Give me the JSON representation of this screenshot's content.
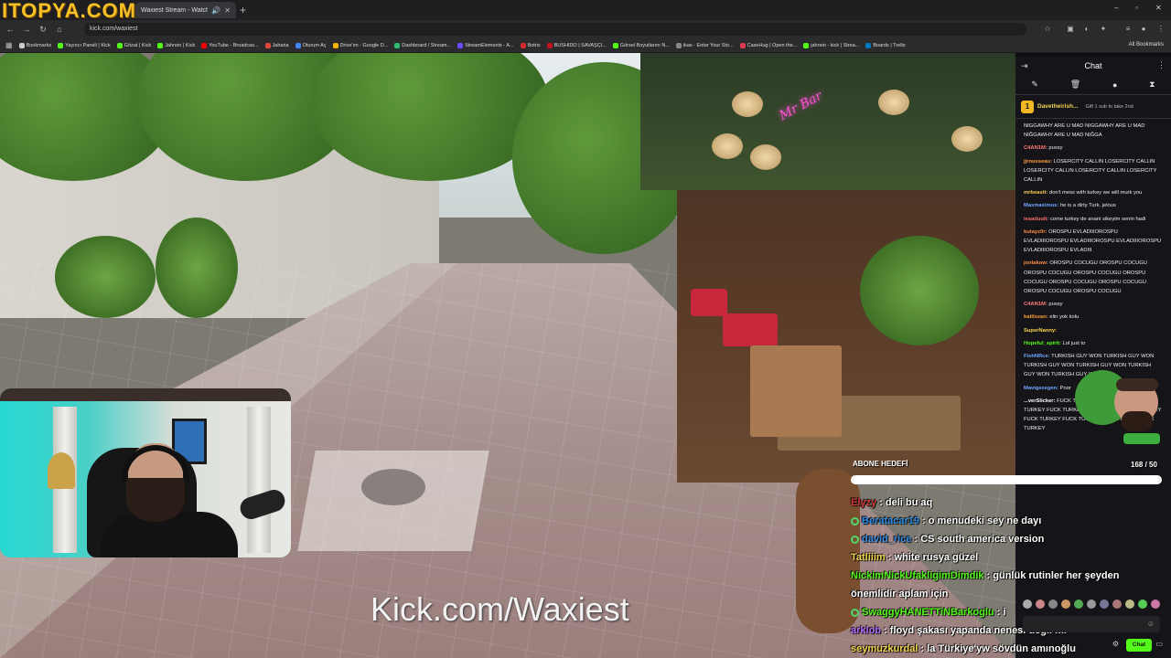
{
  "browser": {
    "watermark": "ITOPYA.COM",
    "tab_title": "Waxiest Stream - Watch Li...",
    "tab_audio_icon": "speaker-icon",
    "new_tab": "+",
    "url": "kick.com/waxiest",
    "window_controls": [
      "–",
      "▫",
      "✕"
    ]
  },
  "bookmarks": {
    "items": [
      {
        "label": "Bookmarks",
        "color": "#cccccc"
      },
      {
        "label": "Yayıncı Paneli | Kick",
        "color": "#53fc18"
      },
      {
        "label": "Gözat | Kick",
        "color": "#53fc18"
      },
      {
        "label": "Jahrein | Kick",
        "color": "#53fc18"
      },
      {
        "label": "YouTube - Broadcas...",
        "color": "#ff0000"
      },
      {
        "label": "Jaharia",
        "color": "#e0463c"
      },
      {
        "label": "Oturum Aç",
        "color": "#4285f4"
      },
      {
        "label": "Drive'ım - Google D...",
        "color": "#f4b400"
      },
      {
        "label": "Dashboard / Stream...",
        "color": "#2dbb6c"
      },
      {
        "label": "StreamElements - A...",
        "color": "#6b4bff"
      },
      {
        "label": "Botrix",
        "color": "#d32a2a"
      },
      {
        "label": "BUSHIDO | SAVAŞÇI...",
        "color": "#c1121f"
      },
      {
        "label": "Görsel Boyutlarını N...",
        "color": "#53fc18"
      },
      {
        "label": "ikas - Enter Your Sto...",
        "color": "#888888"
      },
      {
        "label": "CaseHug | Open the...",
        "color": "#e23a50"
      },
      {
        "label": "jahrein - kick | Strea...",
        "color": "#53fc18"
      },
      {
        "label": "Boards | Trello",
        "color": "#0079bf"
      }
    ],
    "right": "All Bookmarks"
  },
  "video": {
    "watermark_text": "Kick.com/Waxiest",
    "neon_sign": "Mr Bar"
  },
  "sub_goal": {
    "label": "ABONE HEDEFİ",
    "count": "168 / 50",
    "progress": 1.0
  },
  "overlay_chat": [
    {
      "user": "Elyzy",
      "text": ": deli bu aq",
      "color": "#d63b3b",
      "badge": false
    },
    {
      "user": "Beratacar19",
      "text": ": o menudeki sey ne dayı",
      "color": "#2f8fe6",
      "badge": true
    },
    {
      "user": "david_rice",
      "text": ": CS south america version",
      "color": "#3a8fe8",
      "badge": true
    },
    {
      "user": "Tatliiim",
      "text": ": white rusya güzel",
      "color": "#f2d650",
      "badge": false
    },
    {
      "user": "NickimNickUfakligimDimdik",
      "text": ": günlük rutinler her şeyden",
      "color": "#53fc18",
      "badge": false
    },
    {
      "user": "",
      "text": "önemlidir aplam için",
      "color": "#ffffff",
      "badge": false
    },
    {
      "user": "SwaggyHANETTiNBarkoglu",
      "text": ": i",
      "color": "#53fc18",
      "badge": true
    },
    {
      "user": "arklob",
      "text": ": floyd şakası yapanda nenesi değil mi",
      "color": "#b36bff",
      "badge": false
    },
    {
      "user": "seymuzkurdal",
      "text": ": la Türkiye'yw sövdün amınoğlu",
      "color": "#f2d650",
      "badge": false
    }
  ],
  "chat_panel": {
    "title": "Chat",
    "pinned": {
      "user": "Davetheirish...",
      "note": "Gift 1 sub to take 2nd"
    },
    "messages": [
      {
        "user": "",
        "text": "NIGGAWHY ARE U MAD NIGGAWHY ARE U MAD NIĞGAWHY ARE U MAD NIĞGA",
        "color": "#ffffff"
      },
      {
        "user": "C4AN1M:",
        "text": "pussy",
        "color": "#ff7a7a"
      },
      {
        "user": "jjrousseau:",
        "text": "LOSERCITY CALLIN LOSERCITY CALLIN LOSERCITY CALLIN LOSERCITY CALLIN LOSERCITY CALLIN",
        "color": "#ff9b3a"
      },
      {
        "user": "mrbeastt:",
        "text": "don't mess with turkey we will murk you",
        "color": "#ffce4f"
      },
      {
        "user": "Maxmaximus:",
        "text": "he is a dirty Turk. jelous",
        "color": "#6fa8ff"
      },
      {
        "user": "lesaduult:",
        "text": "come turkey de anani sikeyim senin hadi",
        "color": "#ff6b6b"
      },
      {
        "user": "kutayz0r:",
        "text": "OROSPU EVLADIIIOROSPU EVLADIIIOROSPU EVLADIIIOROSPU EVLADIIIOROSPU EVLADIIIOROSPU EVLADIII",
        "color": "#ff8c42"
      },
      {
        "user": "jonlakow:",
        "text": "OROSPU COCUGU OROSPU COCUGU OROSPU COCUGU OROSPU COCUGU OROSPU COCUGU OROSPU COCUGU OROSPU COCUGU OROSPU COCUGU OROSPU COCUGU",
        "color": "#ff8c42"
      },
      {
        "user": "C4AN1M:",
        "text": "pussy",
        "color": "#ff7a7a"
      },
      {
        "user": "katilozan:",
        "text": "elin yok kolu",
        "color": "#ff9b3a"
      },
      {
        "user": "SuperNanny:",
        "text": "",
        "color": "#ffd84f"
      },
      {
        "user": "Hopeful_spirit:",
        "text": "Lol just to",
        "color": "#53fc18"
      },
      {
        "user": "FishNRce:",
        "text": "TURKISH GUY WON TURKISH GUY WON TURKISH GUY WON TURKISH GUY WON TURKISH GUY WON TURKISH GUY WON",
        "color": "#6fa8ff"
      },
      {
        "user": "Mavigezegen:",
        "text": "Poor",
        "color": "#6fa8ff"
      },
      {
        "user": "...verSlicker:",
        "text": "FUCK TURKEY FUCK TURKEY FUCK TURKEY FUCK TURKEY FUCK TURKEY FUCK TURKEY FUCK TURKEY FUCK TURKEY FUCK TURKEY FUCK TURKEY",
        "color": "#ffffff"
      }
    ],
    "send_label": "Chat"
  }
}
